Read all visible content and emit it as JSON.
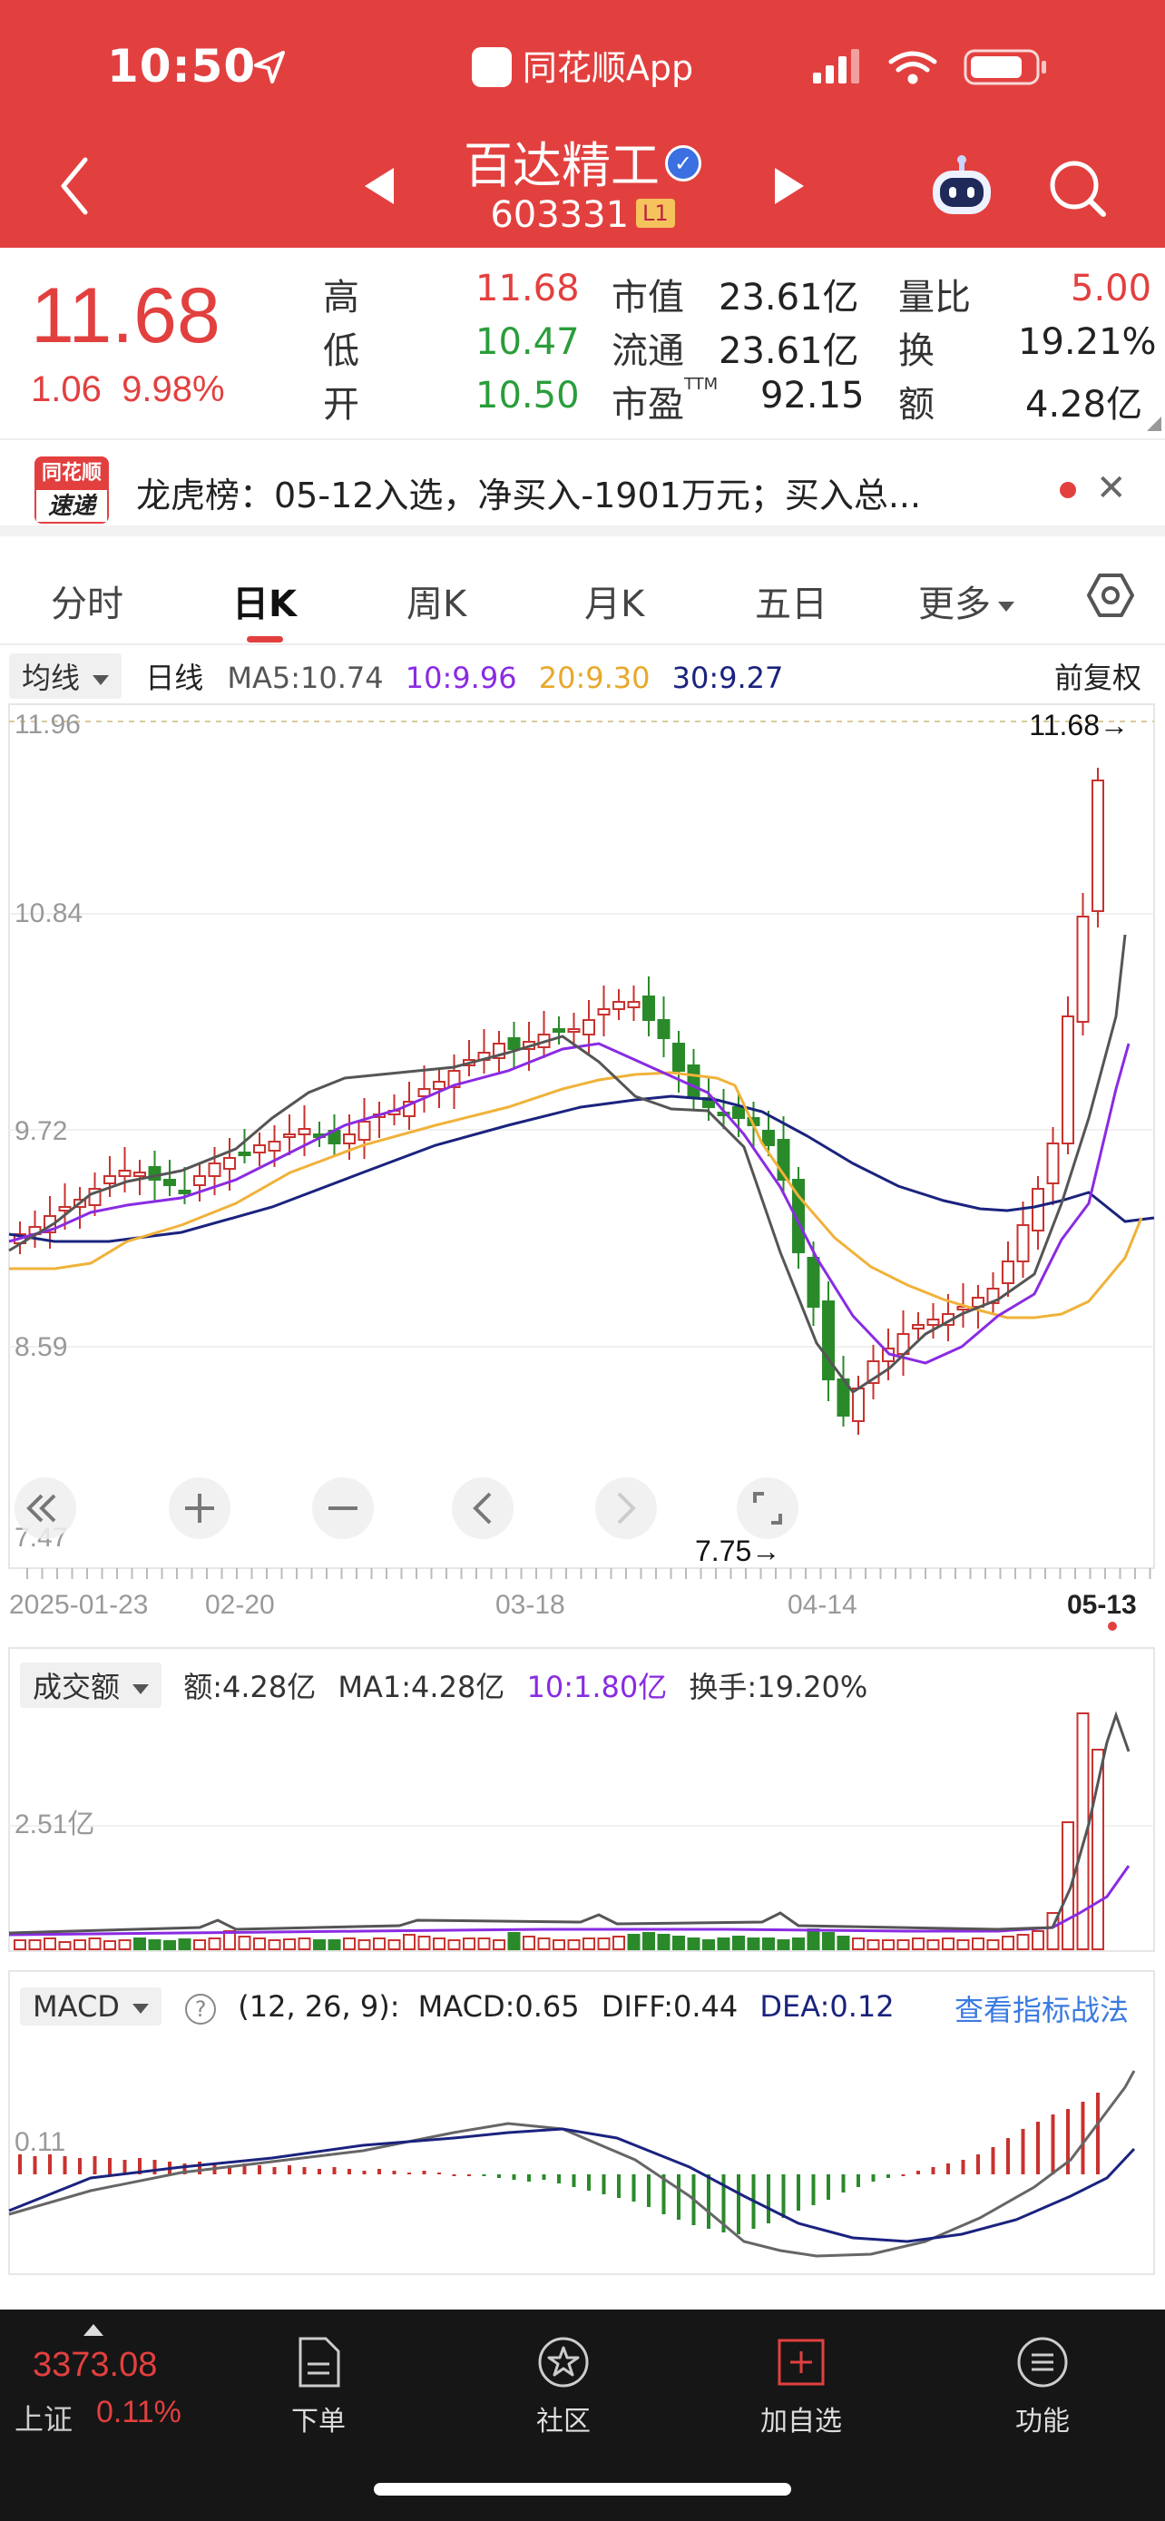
{
  "status_bar": {
    "time": "10:50"
  },
  "header": {
    "app_label": "同花顺App",
    "stock_name": "百达精工",
    "stock_code": "603331",
    "level_badge": "L1"
  },
  "quote": {
    "price": "11.68",
    "change": "1.06",
    "change_pct": "9.98%",
    "fields": [
      {
        "label": "高",
        "value": "11.68",
        "color": "red"
      },
      {
        "label": "低",
        "value": "10.47",
        "color": "green"
      },
      {
        "label": "开",
        "value": "10.50",
        "color": "green"
      }
    ],
    "market_cap_label": "市值",
    "market_cap": "23.61亿",
    "float_cap_label": "流通",
    "float_cap": "23.61亿",
    "pe_label": "市盈",
    "pe_sup": "TTM",
    "pe": "92.15",
    "volume_ratio_label": "量比",
    "volume_ratio": "5.00",
    "turnover_label": "换",
    "turnover": "19.21%",
    "amount_label": "额",
    "amount": "4.28亿"
  },
  "news": {
    "logo_top": "同花顺",
    "logo_bottom": "速递",
    "text": "龙虎榜：05-12入选，净买入-1901万元；买入总..."
  },
  "tabs": [
    {
      "label": "分时"
    },
    {
      "label": "日K"
    },
    {
      "label": "周K"
    },
    {
      "label": "月K"
    },
    {
      "label": "五日"
    },
    {
      "label": "更多"
    }
  ],
  "kline": {
    "indicator_select": "均线",
    "period": "日线",
    "ma5": "MA5:10.74",
    "ma10": "10:9.96",
    "ma20": "20:9.30",
    "ma30": "30:9.27",
    "adjust": "前复权",
    "y_ticks": [
      "11.96",
      "10.84",
      "9.72",
      "8.59",
      "7.47"
    ],
    "high_label": "11.68→",
    "low_label": "7.75→",
    "x_ticks": [
      "2025-01-23",
      "02-20",
      "03-18",
      "04-14",
      "05-13"
    ],
    "colors": {
      "up": "#c8322e",
      "down": "#2a8a2a",
      "ma5": "#555555",
      "ma10": "#8a2be2",
      "ma20": "#f0b23a",
      "ma30": "#1a237e"
    }
  },
  "volume": {
    "indicator_select": "成交额",
    "amount": "额:4.28亿",
    "ma1": "MA1:4.28亿",
    "ma10": "10:1.80亿",
    "turnover": "换手:19.20%",
    "y_tick": "2.51亿"
  },
  "macd": {
    "indicator_select": "MACD",
    "help": "?",
    "params": "(12, 26, 9):",
    "macd": "MACD:0.65",
    "diff": "DIFF:0.44",
    "dea": "DEA:0.12",
    "strategy_link": "查看指标战法",
    "y_tick": "0.11"
  },
  "bottom_nav": {
    "index_value": "3373.08",
    "index_name": "上证",
    "index_pct": "0.11%",
    "items": [
      {
        "label": "下单"
      },
      {
        "label": "社区"
      },
      {
        "label": "加自选"
      },
      {
        "label": "功能"
      }
    ]
  },
  "icons": [
    "location-arrow-icon",
    "signal-icon",
    "wifi-icon",
    "battery-icon",
    "back-icon",
    "prev-stock-icon",
    "next-stock-icon",
    "verified-icon",
    "robot-icon",
    "search-icon",
    "close-icon",
    "settings-icon",
    "rewind-icon",
    "zoom-in-icon",
    "zoom-out-icon",
    "pan-left-icon",
    "pan-right-icon",
    "fullscreen-icon",
    "order-icon",
    "community-icon",
    "add-watchlist-icon",
    "menu-icon"
  ]
}
